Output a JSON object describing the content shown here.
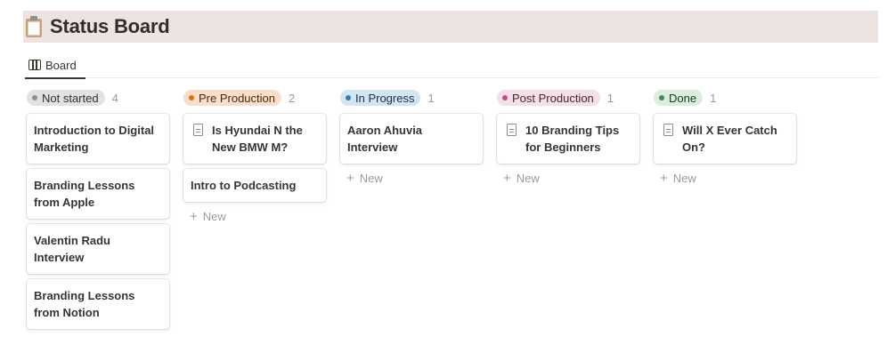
{
  "page": {
    "title": "Status Board",
    "icon": "clipboard-icon"
  },
  "view_tab": {
    "label": "Board",
    "icon": "board-icon"
  },
  "new_label": "New",
  "columns": [
    {
      "label": "Not started",
      "count": "4",
      "pill_bg": "#e3e2e0",
      "dot_color": "#91918e",
      "text_color": "#32302c",
      "cards": [
        {
          "title": "Introduction to Digital Marketing",
          "has_doc_icon": false
        },
        {
          "title": "Branding Lessons from Apple",
          "has_doc_icon": false
        },
        {
          "title": "Valentin Radu Interview",
          "has_doc_icon": false
        },
        {
          "title": "Branding Lessons from Notion",
          "has_doc_icon": false
        }
      ]
    },
    {
      "label": "Pre Production",
      "count": "2",
      "pill_bg": "#fadec9",
      "dot_color": "#d9730d",
      "text_color": "#49290e",
      "cards": [
        {
          "title": "Is Hyundai N the New BMW M?",
          "has_doc_icon": true
        },
        {
          "title": "Intro to Podcasting",
          "has_doc_icon": false
        }
      ]
    },
    {
      "label": "In Progress",
      "count": "1",
      "pill_bg": "#d3e5ef",
      "dot_color": "#337ea9",
      "text_color": "#183347",
      "cards": [
        {
          "title": "Aaron Ahuvia Interview",
          "has_doc_icon": false
        }
      ]
    },
    {
      "label": "Post Production",
      "count": "1",
      "pill_bg": "#f5e0e9",
      "dot_color": "#c14c8a",
      "text_color": "#4c2337",
      "cards": [
        {
          "title": "10 Branding Tips for Beginners",
          "has_doc_icon": true
        }
      ]
    },
    {
      "label": "Done",
      "count": "1",
      "pill_bg": "#dbeddb",
      "dot_color": "#448361",
      "text_color": "#1c3829",
      "cards": [
        {
          "title": "Will X Ever Catch On?",
          "has_doc_icon": true
        }
      ]
    }
  ]
}
